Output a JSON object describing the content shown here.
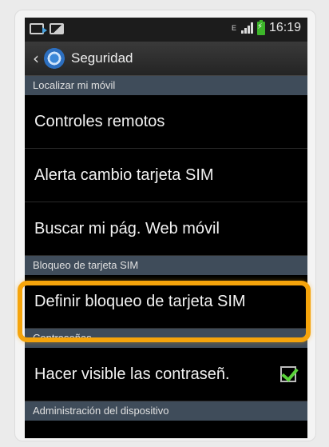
{
  "status_bar": {
    "time": "16:19",
    "data_indicator": "E"
  },
  "header": {
    "title": "Seguridad"
  },
  "sections": [
    {
      "label": "Localizar mi móvil"
    },
    {
      "label": "Bloqueo de tarjeta SIM"
    },
    {
      "label": "Contraseñas"
    },
    {
      "label": "Administración del dispositivo"
    }
  ],
  "items": [
    {
      "label": "Controles remotos"
    },
    {
      "label": "Alerta cambio tarjeta SIM"
    },
    {
      "label": "Buscar mi pág. Web móvil"
    },
    {
      "label": "Definir bloqueo de tarjeta SIM"
    },
    {
      "label": "Hacer visible las contraseñ.",
      "checked": true
    }
  ],
  "colors": {
    "highlight": "#f5a40b",
    "section_bg": "#3f4c5a",
    "check": "#5ad23a"
  }
}
